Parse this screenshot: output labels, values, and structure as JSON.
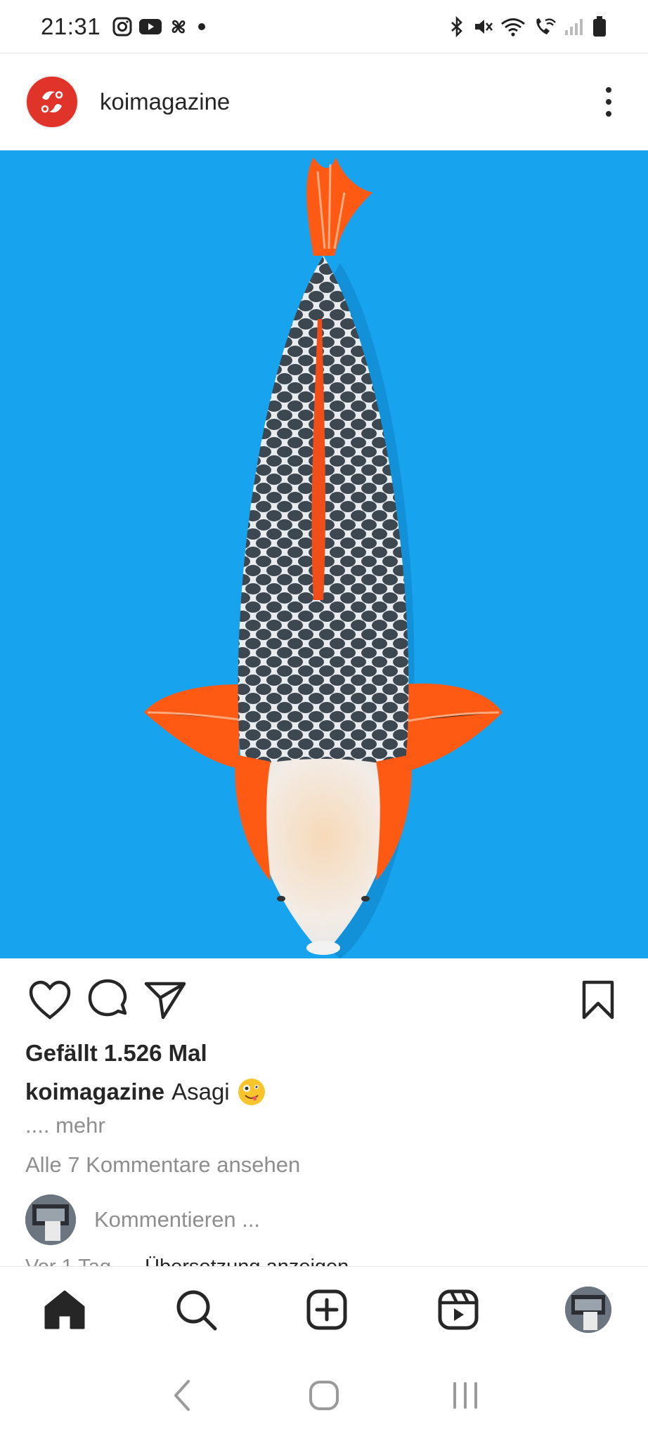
{
  "status_bar": {
    "time": "21:31",
    "left_icons": [
      "instagram-icon",
      "youtube-icon",
      "pinwheel-icon",
      "dot-icon"
    ],
    "right_icons": [
      "bluetooth-icon",
      "mute-icon",
      "wifi-icon",
      "wifi-call-icon",
      "signal-icon",
      "battery-icon"
    ]
  },
  "post": {
    "username": "koimagazine",
    "image_alt": "Asagi",
    "likes": "Gefällt 1.526 Mal",
    "caption_user": "koimagazine",
    "caption_text": "Asagi",
    "caption_emoji": "zany-face-emoji",
    "more": ".... mehr",
    "view_comments": "Alle 7 Kommentare ansehen",
    "comment_placeholder": "Kommentieren ...",
    "timestamp": "Vor 1 Tag",
    "translation": "Übersetzung anzeigen"
  },
  "colors": {
    "background_image": "#18a3ee",
    "logo_red": "#e0342b",
    "text_primary": "#262626",
    "text_secondary": "#8e8e8e"
  },
  "bottom_nav": [
    "home-icon",
    "search-icon",
    "create-icon",
    "reels-icon",
    "profile-avatar"
  ],
  "system_nav": [
    "back-icon",
    "home-circle-icon",
    "recents-icon"
  ]
}
